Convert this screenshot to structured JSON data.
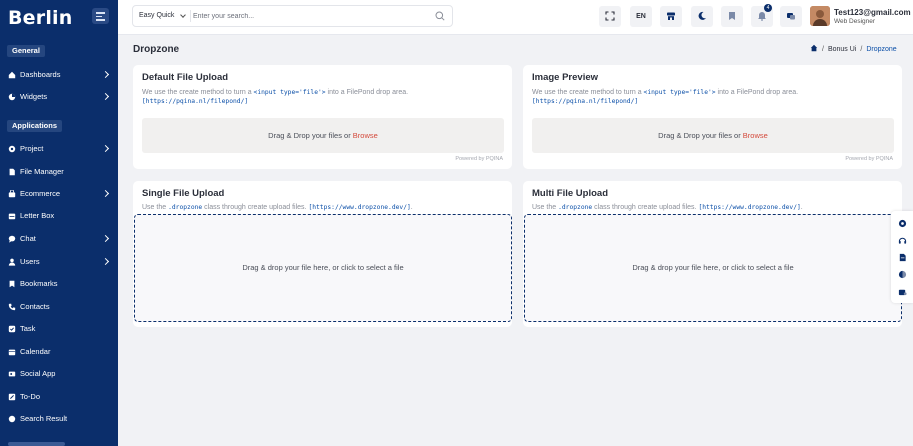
{
  "sidebar": {
    "brand": "Berlin",
    "sections": [
      "General",
      "Applications"
    ],
    "items": [
      {
        "label": "Dashboards",
        "icon": "home-icon",
        "has_arrow": true
      },
      {
        "label": "Widgets",
        "icon": "widgets-icon",
        "has_arrow": true
      },
      {
        "label": "Project",
        "icon": "project-icon",
        "has_arrow": true
      },
      {
        "label": "File Manager",
        "icon": "file-icon",
        "has_arrow": false
      },
      {
        "label": "Ecommerce",
        "icon": "cart-icon",
        "has_arrow": true
      },
      {
        "label": "Letter Box",
        "icon": "inbox-icon",
        "has_arrow": false
      },
      {
        "label": "Chat",
        "icon": "chat-icon",
        "has_arrow": true
      },
      {
        "label": "Users",
        "icon": "user-icon",
        "has_arrow": true
      },
      {
        "label": "Bookmarks",
        "icon": "bookmark-icon",
        "has_arrow": false
      },
      {
        "label": "Contacts",
        "icon": "phone-icon",
        "has_arrow": false
      },
      {
        "label": "Task",
        "icon": "task-icon",
        "has_arrow": false
      },
      {
        "label": "Calendar",
        "icon": "calendar-icon",
        "has_arrow": false
      },
      {
        "label": "Social App",
        "icon": "social-icon",
        "has_arrow": false
      },
      {
        "label": "To-Do",
        "icon": "todo-icon",
        "has_arrow": false
      },
      {
        "label": "Search Result",
        "icon": "search-result-icon",
        "has_arrow": false
      }
    ]
  },
  "header": {
    "search_scope": "Easy Quick",
    "search_placeholder": "Enter your search...",
    "language": "EN",
    "notification_count": "4",
    "user_email": "Test123@gmail.com",
    "user_role": "Web Designer"
  },
  "page": {
    "title": "Dropzone",
    "breadcrumb": [
      "Bonus Ui",
      "Dropzone"
    ]
  },
  "cards": {
    "default_upload": {
      "title": "Default File Upload",
      "desc_pre": "We use the create method to turn a ",
      "desc_code": "<input type='file'>",
      "desc_post": " into a FilePond drop area.",
      "link": "[https://pqina.nl/filepond/]",
      "drop_text": "Drag & Drop your files or ",
      "browse": "Browse",
      "powered": "Powered by PQINA"
    },
    "image_preview": {
      "title": "Image Preview",
      "desc_pre": "We use the create method to turn a ",
      "desc_code": "<input type='file'>",
      "desc_post": " into a FilePond drop area.",
      "link": "[https://pqina.nl/filepond/]",
      "drop_text": "Drag & Drop your files or ",
      "browse": "Browse",
      "powered": "Powered by PQINA"
    },
    "single_upload": {
      "title": "Single File Upload",
      "desc_pre": "Use the ",
      "desc_code": ".dropzone",
      "desc_mid": " class through create upload files. ",
      "desc_link": "[https://www.dropzone.dev/]",
      "desc_post": ".",
      "drop_text": "Drag & drop your file here, or click to select a file"
    },
    "multi_upload": {
      "title": "Multi File Upload",
      "desc_pre": "Use the ",
      "desc_code": ".dropzone",
      "desc_mid": " class through create upload files. ",
      "desc_link": "[https://www.dropzone.dev/]",
      "desc_post": ".",
      "drop_text": "Drag & drop your file here, or click to select a file"
    }
  },
  "colors": {
    "sidebar_bg": "#0b2e6b",
    "accent": "#0b4fa8",
    "browse": "#d44a3c"
  }
}
